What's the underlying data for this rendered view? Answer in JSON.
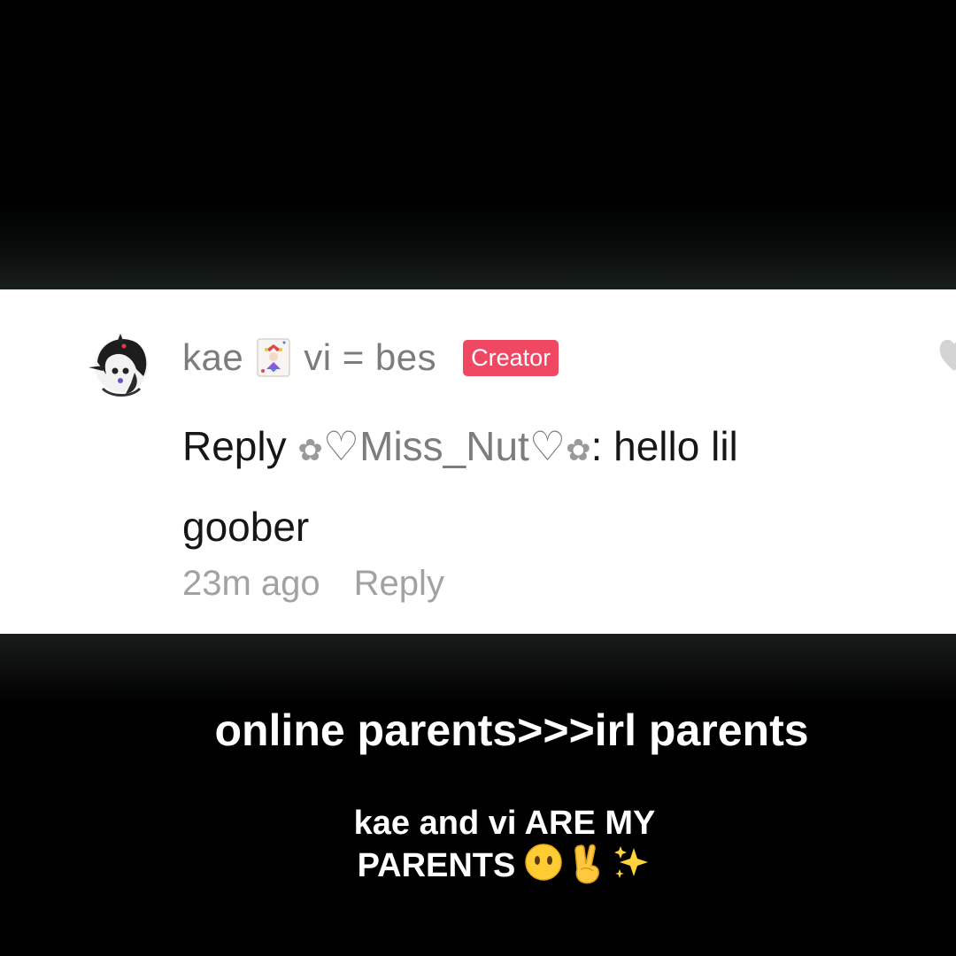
{
  "comment": {
    "username_part1": "kae",
    "username_part2": "vi = bes",
    "badge": "Creator",
    "text_prefix": "Reply ",
    "mention_left_flower": "✿",
    "mention_name": "♡Miss_Nut♡",
    "mention_right_flower": "✿",
    "text_body": ": hello lil goober",
    "time": "23m ago",
    "reply_label": "Reply"
  },
  "caption": {
    "line1": "online parents>>>irl parents",
    "line2a": "kae and vi ARE MY",
    "line2b": "PARENTS"
  },
  "icons": {
    "avatar": "avatar-icon",
    "jester": "jester-card-icon",
    "like": "heart-icon",
    "emojis": [
      "no-mouth-face-icon",
      "victory-hand-icon",
      "sparkles-icon"
    ]
  },
  "colors": {
    "badge": "#f04763",
    "background": "#000000",
    "card": "#ffffff"
  }
}
